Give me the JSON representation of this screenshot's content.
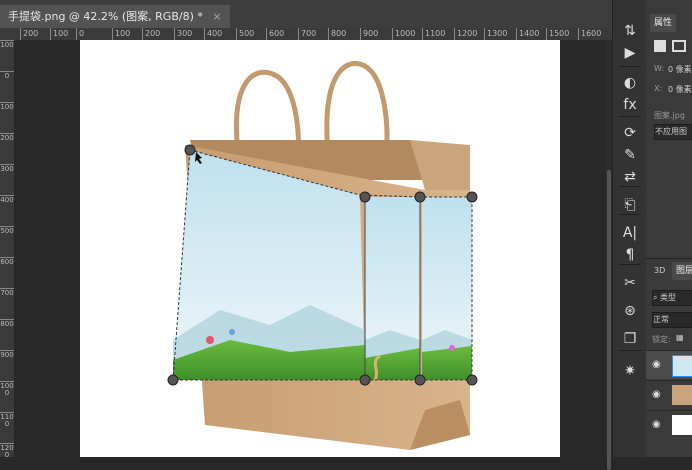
{
  "document_tab": {
    "title": "手提袋.png @ 42.2% (图案, RGB/8) *",
    "close": "×"
  },
  "ruler": {
    "h_ticks": [
      "200",
      "100",
      "0",
      "100",
      "200",
      "300",
      "400",
      "500",
      "600",
      "700",
      "800",
      "900",
      "1000",
      "1100",
      "1200",
      "1300",
      "1400",
      "1500",
      "1600"
    ],
    "v_ticks": [
      "100",
      "0",
      "100",
      "200",
      "300",
      "400",
      "500",
      "600",
      "700",
      "800",
      "900",
      "1000",
      "1100",
      "1200"
    ]
  },
  "toolstrip": {
    "icons": [
      "history-brush-icon",
      "play-icon",
      "color-wheel-icon",
      "fx-icon",
      "rotate-icon",
      "brush-icon",
      "adjust-icon",
      "stamp-icon",
      "text-a-icon",
      "paragraph-icon",
      "tools-cross-icon",
      "pen-icon",
      "document-icon",
      "sparkle-icon"
    ],
    "glyphs": [
      "⇅",
      "▶",
      "◐",
      "fx",
      "⟳",
      "✎",
      "⇄",
      "⎗",
      "A|",
      "¶",
      "✂",
      "⊛",
      "❐",
      "✷"
    ]
  },
  "properties_panel": {
    "tab": "属性",
    "w_label": "W:",
    "w_value": "0 像素",
    "x_label": "X:",
    "x_value": "0 像素",
    "source_label": "图案.jpg",
    "source_value": "不应用图"
  },
  "layers_panel": {
    "tab_3d": "3D",
    "tab_layers": "图层",
    "search_placeholder": "类型",
    "blend_mode": "正常",
    "lock_label": "锁定:",
    "layers_count": 3
  },
  "colors": {
    "accent": "#2d8cf0",
    "bag": "#c9a27a",
    "grass": "#5aa83a",
    "sky": "#d3eaf3"
  }
}
